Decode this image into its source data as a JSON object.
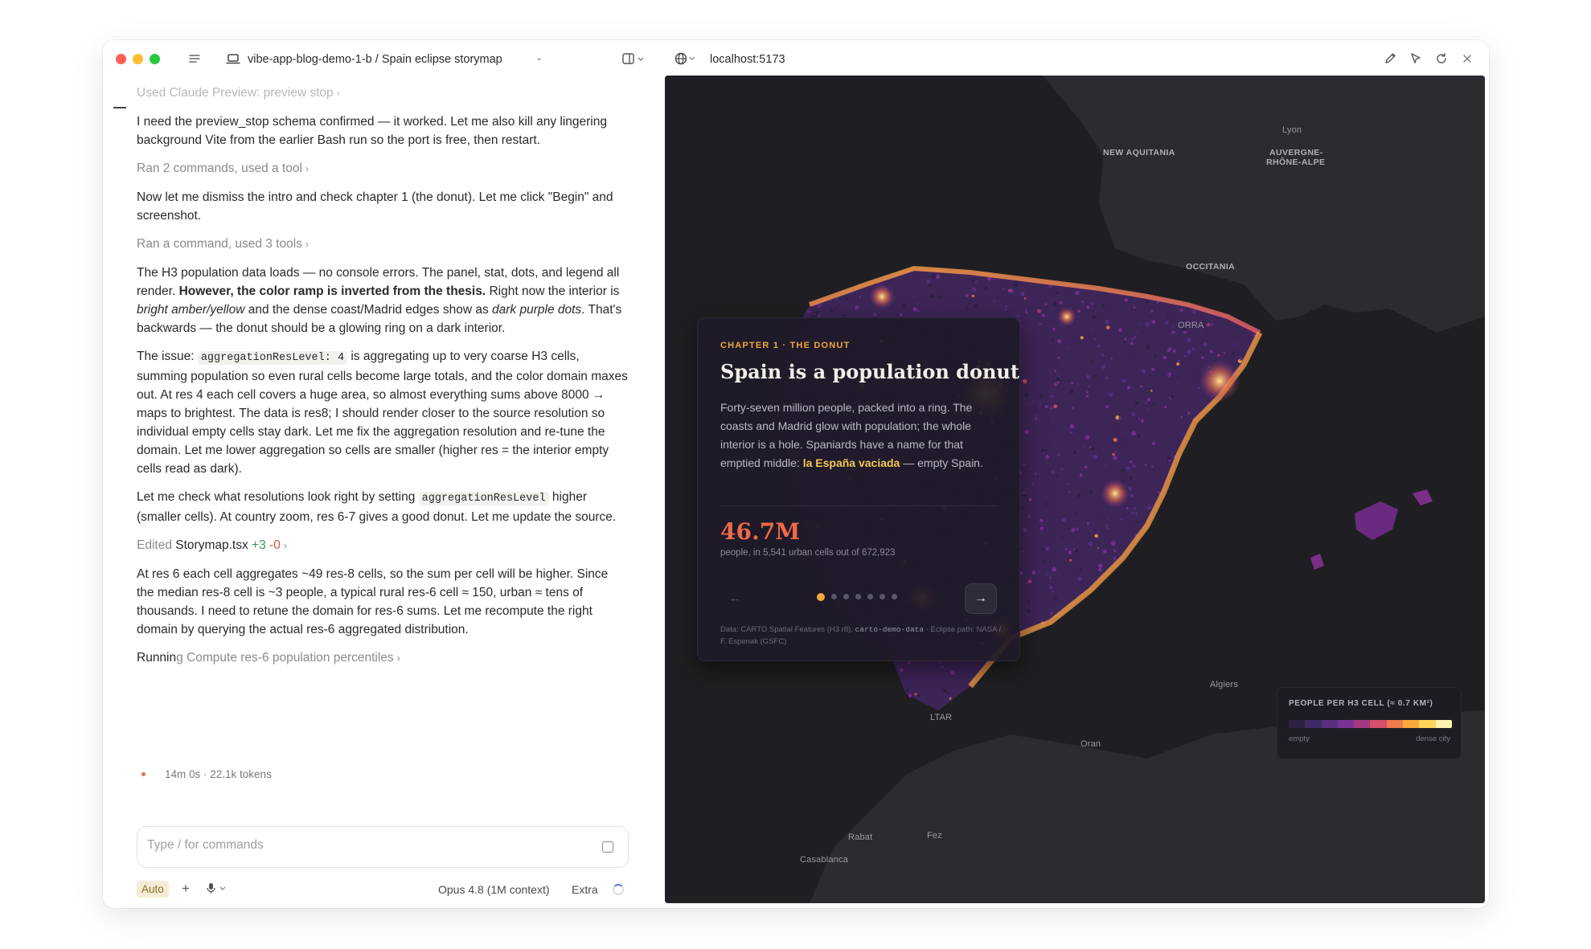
{
  "chat": {
    "project": "vibe-app-blog-demo-1-b",
    "separator": " / ",
    "session": "Spain eclipse storymap",
    "tool_preview_stop": "Used Claude Preview: preview stop",
    "msg1": "I need the preview_stop schema confirmed — it worked. Let me also kill any lingering background Vite from the earlier Bash run so the port is free, then restart.",
    "tool_ran_2": "Ran 2 commands, used a tool",
    "msg2": "Now let me dismiss the intro and check chapter 1 (the donut). Let me click \"Begin\" and screenshot.",
    "tool_ran_1": "Ran a command, used 3 tools",
    "msg3": {
      "a": "The H3 population data loads — no console errors. The panel, stat, dots, and legend all render. ",
      "b": "However, the color ramp is inverted from the thesis.",
      "c": " Right now the interior is ",
      "d": "bright amber/yellow",
      "e": " and the dense coast/Madrid edges show as ",
      "f": "dark purple dots",
      "g": ". That's backwards — the donut should be a glowing ring on a dark interior."
    },
    "msg4": {
      "a": "The issue: ",
      "code": "aggregationResLevel: 4",
      "b": " is aggregating up to very coarse H3 cells, summing population so even rural cells become large totals, and the color domain maxes out. At res 4 each cell covers a huge area, so almost everything sums above 8000 → maps to brightest. The data is res8; I should render closer to the source resolution so individual empty cells stay dark. Let me fix the aggregation resolution and re-tune the domain. Let me lower aggregation so cells are smaller (higher res = the interior empty cells read as dark)."
    },
    "msg5": {
      "a": "Let me check what resolutions look right by setting ",
      "code": "aggregationResLevel",
      "b": " higher (smaller cells). At country zoom, res 6-7 gives a good donut. Let me update the source."
    },
    "edited": {
      "verb": "Edited ",
      "file": "Storymap.tsx",
      "add": "+3",
      "del": "-0"
    },
    "msg6": "At res 6 each cell aggregates ~49 res-8 cells, so the sum per cell will be higher. Since the median res-8 cell is ~3 people, a typical rural res-6 cell ≈ 150, urban ≈ tens of thousands. I need to retune the domain for res-6 sums. Let me recompute the right domain by querying the actual res-6 aggregated distribution.",
    "running": {
      "prefix": "Runnin",
      "suffix": "g Compute res-6 population percentiles"
    },
    "status": "14m 0s · 22.1k tokens",
    "composer_placeholder": "Type / for commands",
    "mode": "Auto",
    "model": "Opus 4.8 (1M context)",
    "effort": "Extra"
  },
  "browser": {
    "url": "localhost:5173"
  },
  "map": {
    "places": {
      "new_aquitania": "NEW AQUITANIA",
      "occitania": "OCCITANIA",
      "lyon": "Lyon",
      "auvergne": "AUVERGNE-",
      "rhone": "RHÔNE-ALPE",
      "andorra": "ORRA",
      "algiers": "Algiers",
      "oran": "Oran",
      "rabat": "Rabat",
      "fez": "Fez",
      "casablanca": "Casablanca",
      "gibraltar": "LTAR"
    },
    "card": {
      "kicker": "CHAPTER 1 · THE DONUT",
      "title": "Spain is a population donut",
      "body_a": "Forty-seven million people, packed into a ring. The coasts and Madrid glow with population; the whole interior is a hole. Spaniards have a name for that emptied middle: ",
      "body_hl": "la España vaciada",
      "body_b": " — empty Spain.",
      "stat": "46.7M",
      "stat_caption": "people, in 5,541 urban cells out of 672,923",
      "credit_a": "Data: CARTO Spatial Features (H3 r8), ",
      "credit_code": "carto-demo-data",
      "credit_b": " · Eclipse path: NASA / F. Espenak (GSFC)",
      "pages": 7,
      "active_page": 1
    },
    "legend": {
      "title": "PEOPLE PER H3 CELL (≈ 0.7 KM²)",
      "min_label": "empty",
      "max_label": "dense city",
      "ramp": [
        "#2a2240",
        "#3d2a66",
        "#5a2f82",
        "#7b3191",
        "#a5397f",
        "#d2506a",
        "#ef7a4c",
        "#f9a93c",
        "#fbd55a",
        "#fff3b0"
      ]
    },
    "colors": {
      "land": "#2b2b30",
      "sea": "#1f1f23",
      "accent": "#f1a93a"
    }
  }
}
